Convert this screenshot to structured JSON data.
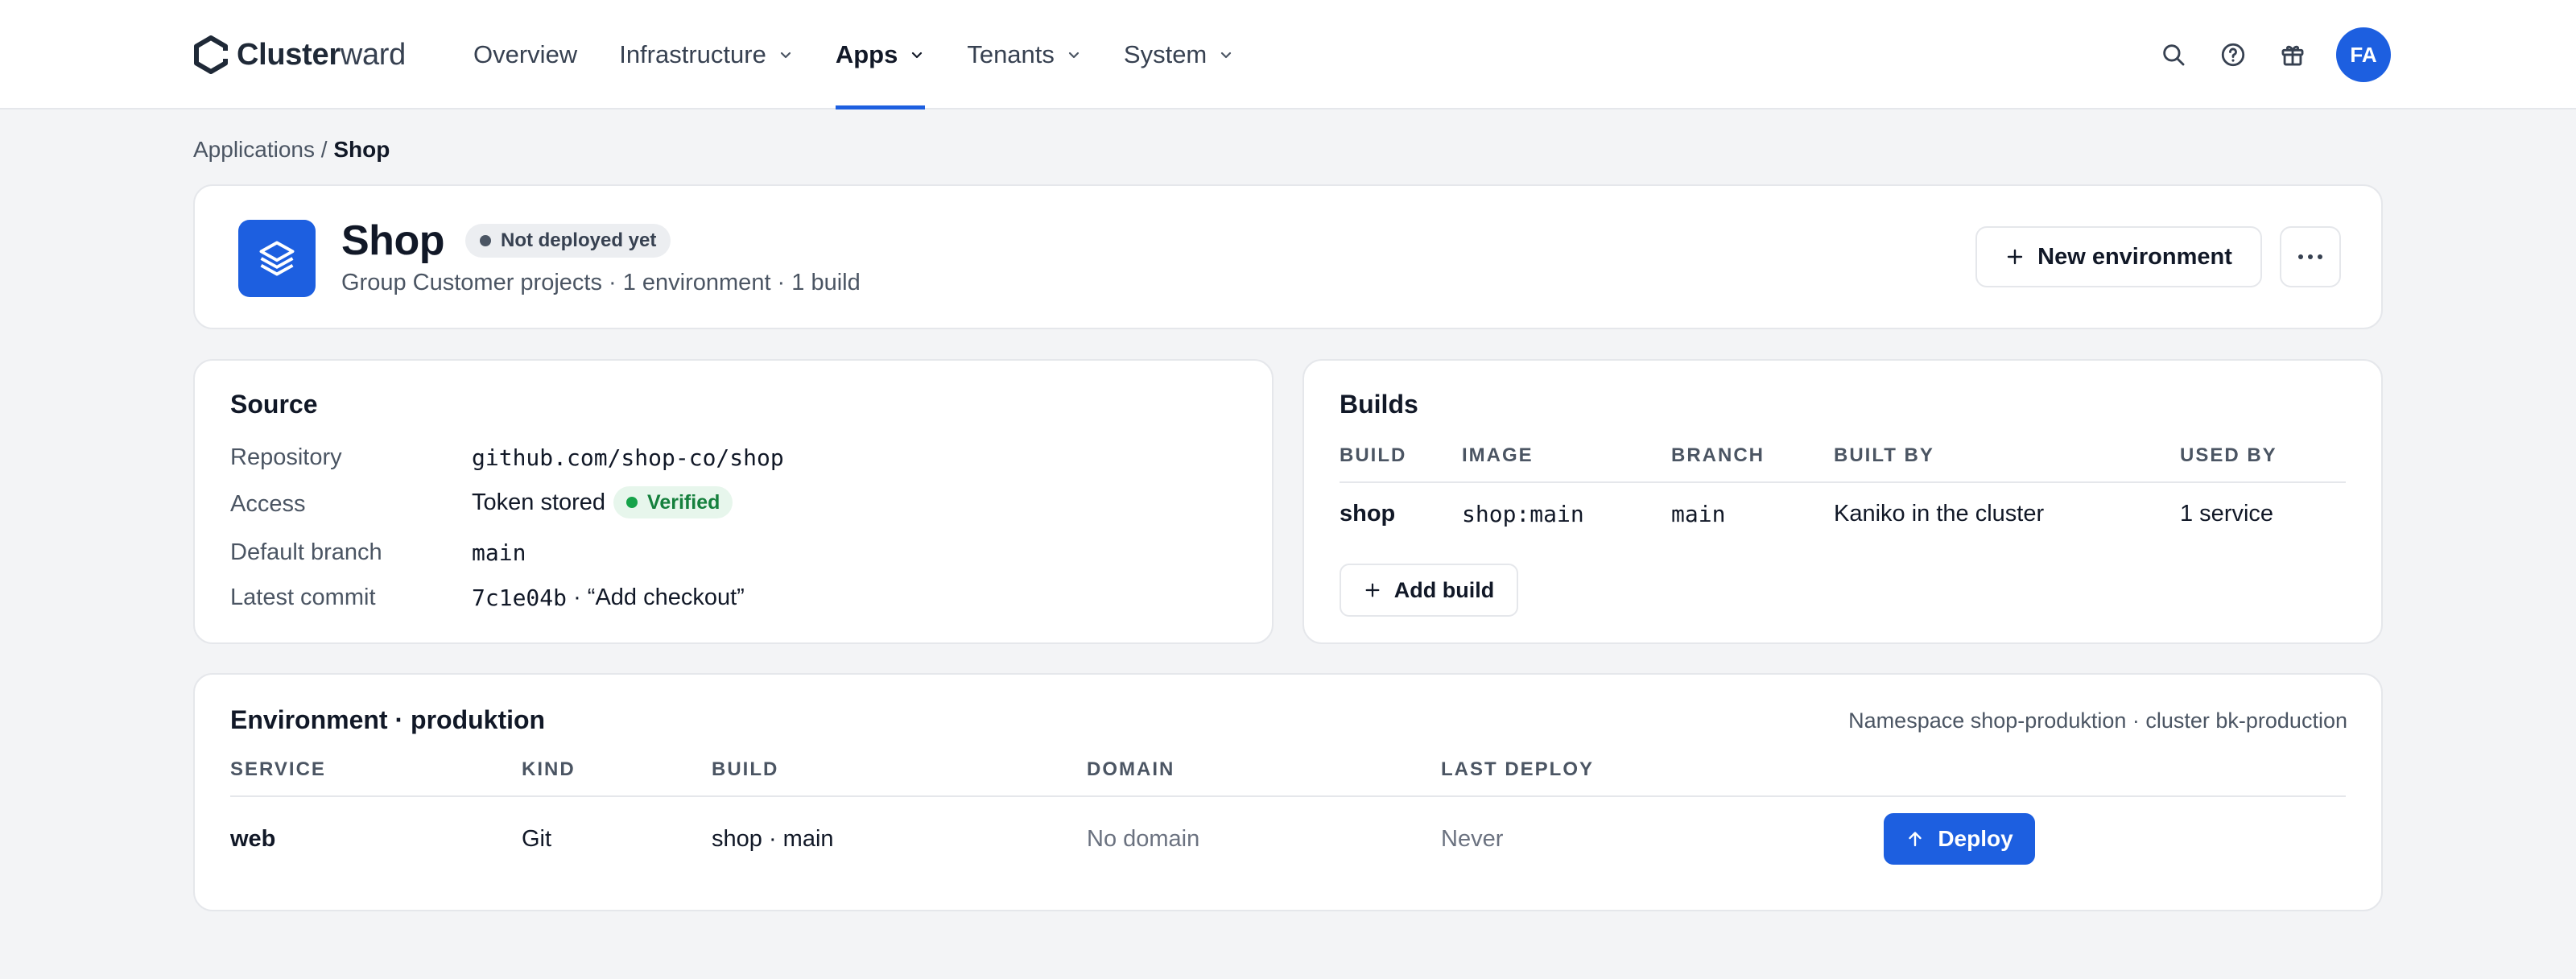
{
  "brand": {
    "name_bold": "Cluster",
    "name_rest": "ward"
  },
  "nav": [
    {
      "label": "Overview",
      "dropdown": false,
      "active": false
    },
    {
      "label": "Infrastructure",
      "dropdown": true,
      "active": false
    },
    {
      "label": "Apps",
      "dropdown": true,
      "active": true
    },
    {
      "label": "Tenants",
      "dropdown": true,
      "active": false
    },
    {
      "label": "System",
      "dropdown": true,
      "active": false
    }
  ],
  "user": {
    "initials": "FA"
  },
  "breadcrumb": {
    "parent": "Applications",
    "separator": " / ",
    "current": "Shop"
  },
  "app": {
    "title": "Shop",
    "status": "Not deployed yet",
    "subtitle": "Group Customer projects · 1 environment · 1 build",
    "new_environment_label": "New environment"
  },
  "source": {
    "title": "Source",
    "rows": [
      {
        "label": "Repository",
        "value": "github.com/shop-co/shop"
      },
      {
        "label": "Access",
        "value": "Token stored",
        "badge": "Verified"
      },
      {
        "label": "Default branch",
        "value": "main"
      },
      {
        "label": "Latest commit",
        "hash": "7c1e04b",
        "message": " · “Add checkout”"
      }
    ]
  },
  "builds": {
    "title": "Builds",
    "columns": [
      "BUILD",
      "IMAGE",
      "BRANCH",
      "BUILT BY",
      "USED BY"
    ],
    "rows": [
      {
        "build": "shop",
        "image": "shop:main",
        "branch": "main",
        "built_by": "Kaniko in the cluster",
        "used_by": "1 service"
      }
    ],
    "add_label": "Add build"
  },
  "environment": {
    "title": "Environment · produktion",
    "meta": "Namespace shop-produktion · cluster bk-production",
    "columns": [
      "SERVICE",
      "KIND",
      "BUILD",
      "DOMAIN",
      "LAST DEPLOY"
    ],
    "rows": [
      {
        "service": "web",
        "kind": "Git",
        "build": "shop · main",
        "domain": "No domain",
        "last_deploy": "Never",
        "action": "Deploy"
      }
    ]
  },
  "colors": {
    "accent": "#1d5fe0",
    "success": "#15803d",
    "background": "#f3f4f6"
  }
}
